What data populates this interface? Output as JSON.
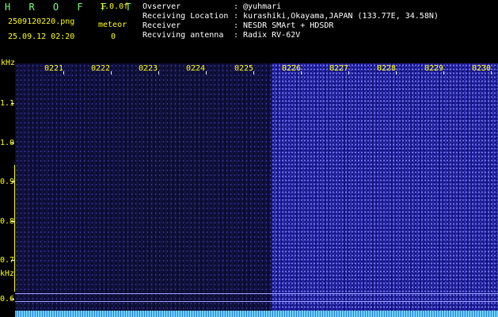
{
  "header": {
    "title": "H R O F F T",
    "version": "1.0.0f",
    "filename": "2509120220.png",
    "meteor_label": "meteor",
    "datetime": "25.09.12 02:20",
    "meteor_count": "0"
  },
  "info": {
    "observer_label": "Ovserver",
    "observer_value": ": @yuhmari",
    "location_label": "Receiving Location",
    "location_value": ": kurashiki,Okayama,JAPAN (133.77E, 34.58N)",
    "receiver_label": "Receiver",
    "receiver_value": ": NESDR SMArt + HDSDR",
    "antenna_label": "Recviving antenna",
    "antenna_value": ": Radix RV-62V"
  },
  "axis": {
    "unit_top": "kHz",
    "unit_mid": "kHz",
    "y_ticks": [
      "1.1",
      "1.0",
      "0.9",
      "0.8",
      "0.7",
      "0.6"
    ],
    "x_ticks": [
      "0221",
      "0222",
      "0223",
      "0224",
      "0225",
      "0226",
      "0227",
      "0228",
      "0229",
      "0230"
    ]
  }
}
